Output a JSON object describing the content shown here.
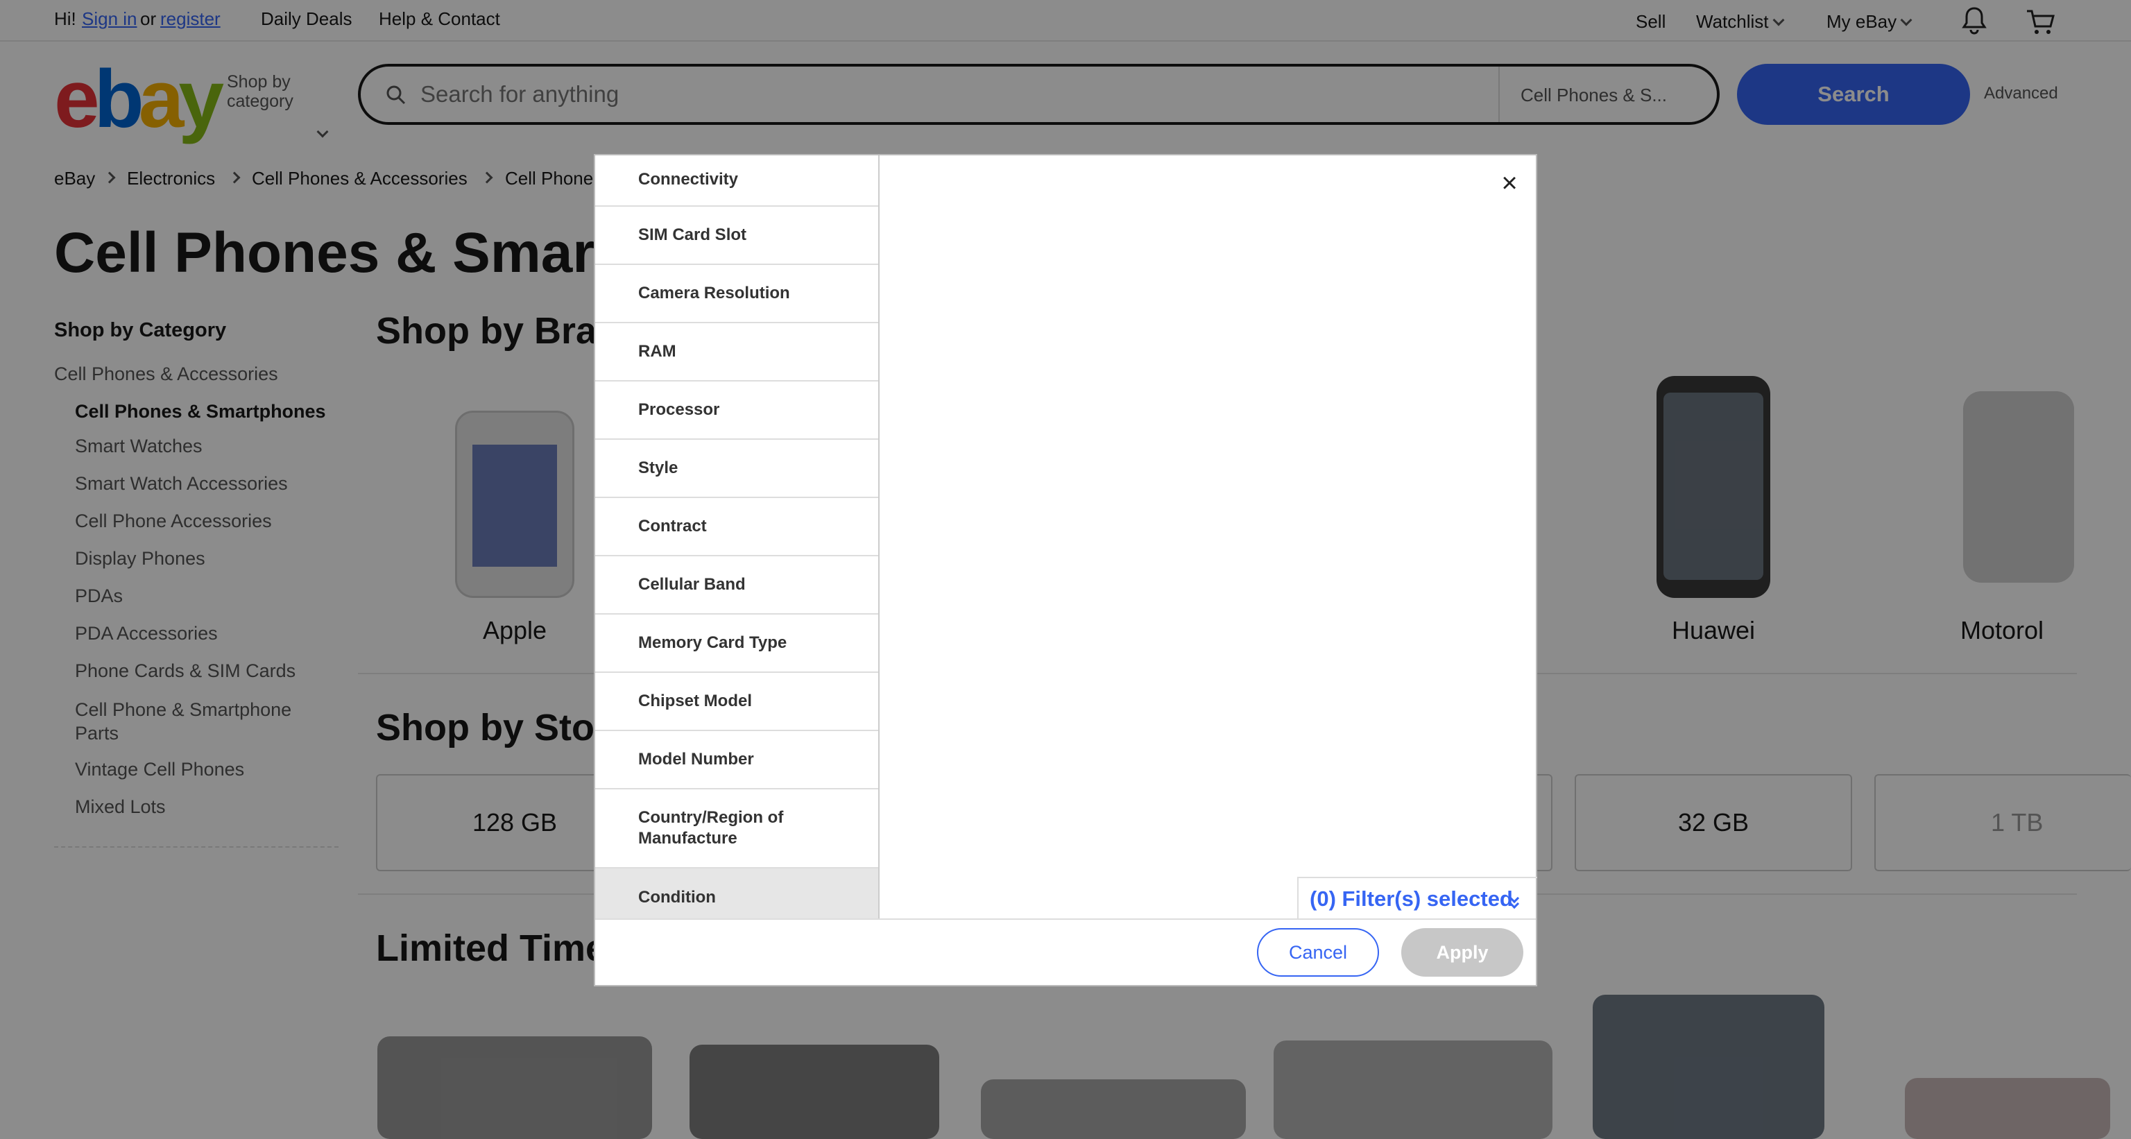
{
  "topbar": {
    "greeting": "Hi!",
    "sign_in": "Sign in",
    "or": "or",
    "register": "register",
    "daily_deals": "Daily Deals",
    "help": "Help & Contact",
    "sell": "Sell",
    "watchlist": "Watchlist",
    "my_ebay": "My eBay"
  },
  "header": {
    "logo_letters": [
      "e",
      "b",
      "a",
      "y"
    ],
    "shop_by": "Shop by",
    "category": "category",
    "search_placeholder": "Search for anything",
    "category_select": "Cell Phones & S...",
    "search_button": "Search",
    "advanced": "Advanced"
  },
  "breadcrumb": [
    "eBay",
    "Electronics",
    "Cell Phones & Accessories",
    "Cell Phone"
  ],
  "page_title": "Cell Phones & Smartp",
  "sidebar": {
    "heading": "Shop by Category",
    "parent": "Cell Phones & Accessories",
    "current": "Cell Phones & Smartphones",
    "items": [
      "Smart Watches",
      "Smart Watch Accessories",
      "Cell Phone Accessories",
      "Display Phones",
      "PDAs",
      "PDA Accessories",
      "Phone Cards & SIM Cards",
      "Cell Phone & Smartphone Parts",
      "Vintage Cell Phones",
      "Mixed Lots"
    ]
  },
  "sections": {
    "brand_title": "Shop by Brand",
    "storage_title": "Shop by Stora",
    "limited_title": "Limited Time"
  },
  "brands": [
    "Apple",
    "Huawei",
    "Motorol"
  ],
  "storage": [
    "128 GB",
    "32 GB",
    "1 TB"
  ],
  "modal": {
    "filters": [
      "Connectivity",
      "SIM Card Slot",
      "Camera Resolution",
      "RAM",
      "Processor",
      "Style",
      "Contract",
      "Cellular Band",
      "Memory Card Type",
      "Chipset Model",
      "Model Number",
      "Country/Region of Manufacture",
      "Condition"
    ],
    "active_filter": "Condition",
    "filters_selected": "(0) Filter(s) selected",
    "cancel": "Cancel",
    "apply": "Apply",
    "close_glyph": "×"
  },
  "colors": {
    "accent": "#3665f3",
    "logo_e": "#e53238",
    "logo_b": "#0064d2",
    "logo_a": "#f5af02",
    "logo_y": "#86b817"
  }
}
